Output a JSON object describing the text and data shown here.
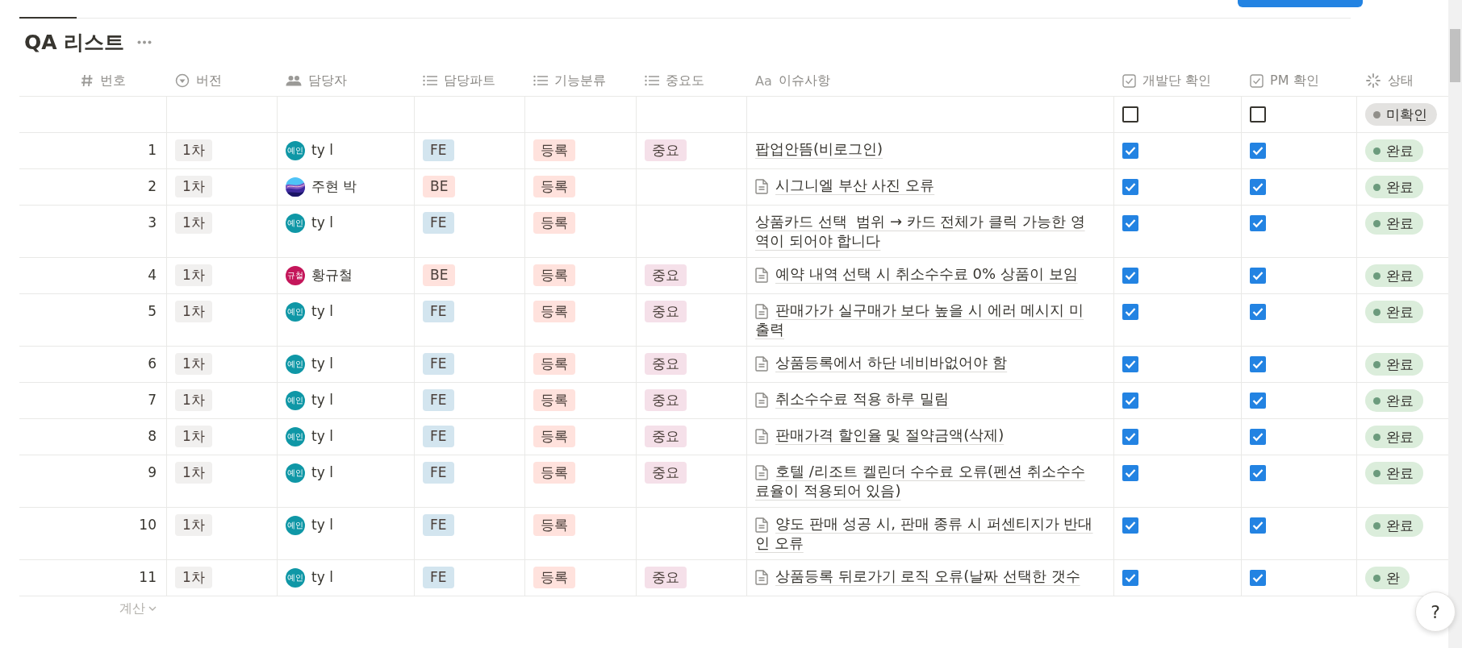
{
  "title": "QA 리스트",
  "columns": [
    {
      "label": "번호",
      "kind": "number"
    },
    {
      "label": "버전",
      "kind": "select"
    },
    {
      "label": "담당자",
      "kind": "person"
    },
    {
      "label": "담당파트",
      "kind": "multi_select"
    },
    {
      "label": "기능분류",
      "kind": "multi_select"
    },
    {
      "label": "중요도",
      "kind": "multi_select"
    },
    {
      "label": "이슈사항",
      "kind": "title",
      "type_glyph": "Aa"
    },
    {
      "label": "개발단 확인",
      "kind": "checkbox"
    },
    {
      "label": "PM 확인",
      "kind": "checkbox"
    },
    {
      "label": "상태",
      "kind": "status"
    }
  ],
  "draft_row": {
    "dev_checked": false,
    "pm_checked": false,
    "status": {
      "label": "미확인",
      "color": "#918f8a"
    }
  },
  "rows": [
    {
      "number": "1",
      "version": "1차",
      "assignee": {
        "kind": "initials",
        "avatar_text": "예인",
        "color": "#0f97a6",
        "name": "ty l"
      },
      "part": {
        "label": "FE",
        "color": "#d3e5ef"
      },
      "category": {
        "label": "등록",
        "color": "#ffe2dd"
      },
      "importance": {
        "label": "중요",
        "color": "#f5e0e9"
      },
      "issue": "팝업안뜸(비로그인)",
      "page_icon": false,
      "dev_checked": true,
      "pm_checked": true,
      "status": {
        "label": "완료",
        "color": "#6c9b7d"
      }
    },
    {
      "number": "2",
      "version": "1차",
      "assignee": {
        "name": "주현 박"
      },
      "part": {
        "label": "BE",
        "color": "#ffe2dd"
      },
      "category": {
        "label": "등록",
        "color": "#ffe2dd"
      },
      "issue": "시그니엘 부산 사진 오류",
      "page_icon": true,
      "dev_checked": true,
      "pm_checked": true,
      "status": {
        "label": "완료",
        "color": "#6c9b7d"
      }
    },
    {
      "number": "3",
      "version": "1차",
      "assignee": {
        "kind": "initials",
        "avatar_text": "예인",
        "color": "#0f97a6",
        "name": "ty l"
      },
      "part": {
        "label": "FE",
        "color": "#d3e5ef"
      },
      "category": {
        "label": "등록",
        "color": "#ffe2dd"
      },
      "issue": "상품카드 선택  범위 → 카드 전체가 클릭 가능한 영역이 되어야 합니다",
      "page_icon": false,
      "dev_checked": true,
      "pm_checked": true,
      "status": {
        "label": "완료",
        "color": "#6c9b7d"
      }
    },
    {
      "number": "4",
      "version": "1차",
      "assignee": {
        "kind": "initials",
        "avatar_text": "규철",
        "color": "#c4165a",
        "name": "황규철"
      },
      "part": {
        "label": "BE",
        "color": "#ffe2dd"
      },
      "category": {
        "label": "등록",
        "color": "#ffe2dd"
      },
      "importance": {
        "label": "중요",
        "color": "#f5e0e9"
      },
      "issue": "예약 내역 선택 시 취소수수료 0% 상품이 보임",
      "page_icon": true,
      "dev_checked": true,
      "pm_checked": true,
      "status": {
        "label": "완료",
        "color": "#6c9b7d"
      }
    },
    {
      "number": "5",
      "version": "1차",
      "assignee": {
        "kind": "initials",
        "avatar_text": "예인",
        "color": "#0f97a6",
        "name": "ty l"
      },
      "part": {
        "label": "FE",
        "color": "#d3e5ef"
      },
      "category": {
        "label": "등록",
        "color": "#ffe2dd"
      },
      "importance": {
        "label": "중요",
        "color": "#f5e0e9"
      },
      "issue": "판매가가 실구매가 보다 높을 시 에러 메시지 미출력",
      "page_icon": true,
      "dev_checked": true,
      "pm_checked": true,
      "status": {
        "label": "완료",
        "color": "#6c9b7d"
      }
    },
    {
      "number": "6",
      "version": "1차",
      "assignee": {
        "kind": "initials",
        "avatar_text": "예인",
        "color": "#0f97a6",
        "name": "ty l"
      },
      "part": {
        "label": "FE",
        "color": "#d3e5ef"
      },
      "category": {
        "label": "등록",
        "color": "#ffe2dd"
      },
      "importance": {
        "label": "중요",
        "color": "#f5e0e9"
      },
      "issue": "상품등록에서 하단 네비바없어야 함",
      "page_icon": true,
      "dev_checked": true,
      "pm_checked": true,
      "status": {
        "label": "완료",
        "color": "#6c9b7d"
      }
    },
    {
      "number": "7",
      "version": "1차",
      "assignee": {
        "kind": "initials",
        "avatar_text": "예인",
        "color": "#0f97a6",
        "name": "ty l"
      },
      "part": {
        "label": "FE",
        "color": "#d3e5ef"
      },
      "category": {
        "label": "등록",
        "color": "#ffe2dd"
      },
      "importance": {
        "label": "중요",
        "color": "#f5e0e9"
      },
      "issue": "취소수수료 적용 하루 밀림",
      "page_icon": true,
      "dev_checked": true,
      "pm_checked": true,
      "status": {
        "label": "완료",
        "color": "#6c9b7d"
      }
    },
    {
      "number": "8",
      "version": "1차",
      "assignee": {
        "kind": "initials",
        "avatar_text": "예인",
        "color": "#0f97a6",
        "name": "ty l"
      },
      "part": {
        "label": "FE",
        "color": "#d3e5ef"
      },
      "category": {
        "label": "등록",
        "color": "#ffe2dd"
      },
      "importance": {
        "label": "중요",
        "color": "#f5e0e9"
      },
      "issue": "판매가격 할인율 및 절약금액(삭제)",
      "page_icon": true,
      "dev_checked": true,
      "pm_checked": true,
      "status": {
        "label": "완료",
        "color": "#6c9b7d"
      }
    },
    {
      "number": "9",
      "version": "1차",
      "assignee": {
        "kind": "initials",
        "avatar_text": "예인",
        "color": "#0f97a6",
        "name": "ty l"
      },
      "part": {
        "label": "FE",
        "color": "#d3e5ef"
      },
      "category": {
        "label": "등록",
        "color": "#ffe2dd"
      },
      "importance": {
        "label": "중요",
        "color": "#f5e0e9"
      },
      "issue": "호텔 /리조트 켈린더 수수료 오류(펜션 취소수수료율이 적용되어 있음)",
      "page_icon": true,
      "dev_checked": true,
      "pm_checked": true,
      "status": {
        "label": "완료",
        "color": "#6c9b7d"
      }
    },
    {
      "number": "10",
      "version": "1차",
      "assignee": {
        "kind": "initials",
        "avatar_text": "예인",
        "color": "#0f97a6",
        "name": "ty l"
      },
      "part": {
        "label": "FE",
        "color": "#d3e5ef"
      },
      "category": {
        "label": "등록",
        "color": "#ffe2dd"
      },
      "issue": "양도 판매 성공 시, 판매 종류 시 퍼센티지가 반대인 오류",
      "page_icon": true,
      "dev_checked": true,
      "pm_checked": true,
      "status": {
        "label": "완료",
        "color": "#6c9b7d"
      }
    },
    {
      "number": "11",
      "version": "1차",
      "assignee": {
        "kind": "initials",
        "avatar_text": "예인",
        "color": "#0f97a6",
        "name": "ty l"
      },
      "part": {
        "label": "FE",
        "color": "#d3e5ef"
      },
      "category": {
        "label": "등록",
        "color": "#ffe2dd"
      },
      "importance": {
        "label": "중요",
        "color": "#f5e0e9"
      },
      "issue": "상품등록 뒤로가기 로직 오류(날짜 선택한 갯수",
      "page_icon": true,
      "dev_checked": true,
      "pm_checked": true,
      "status": {
        "label": "완",
        "color": "#6c9b7d"
      }
    }
  ],
  "footer": {
    "label": "계산"
  },
  "help_button": "?"
}
